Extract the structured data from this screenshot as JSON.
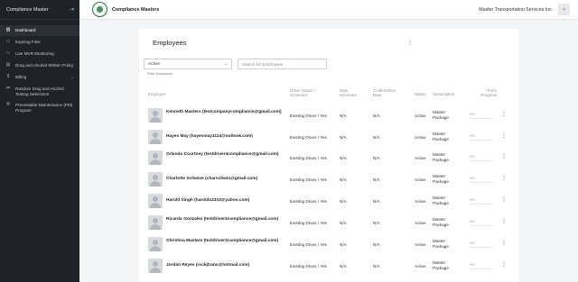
{
  "sidebar": {
    "title": "Compliance Master",
    "collapse_icon": "collapse-left-icon",
    "items": [
      {
        "label": "Dashboard",
        "icon": "chart-icon",
        "active": true
      },
      {
        "label": "Expiring Files",
        "icon": "folder-icon"
      },
      {
        "label": "Live MVR Monitoring",
        "icon": "pulse-icon"
      },
      {
        "label": "Drug and Alcohol Written Policy",
        "icon": "document-icon"
      },
      {
        "label": "Billing",
        "icon": "dollar-icon",
        "caret": "⌄"
      },
      {
        "label": "Random Drug and Alcohol Testing Selections",
        "icon": "shuffle-icon"
      },
      {
        "label": "Preventable Maintenance (PM) Program",
        "icon": "wrench-icon"
      }
    ]
  },
  "topbar": {
    "brand": "Compliance Masters",
    "company": "Master Transportation Services Inc."
  },
  "employees": {
    "title": "Employees",
    "menu_glyph": "⋮",
    "status_value": "Active",
    "search_placeholder": "Search for Employees",
    "filter_label": "Filter Employees",
    "columns": {
      "employee": "Employee",
      "driver_status": "Driver Status / Screened",
      "date_screened": "Date Screened",
      "confirmation_date": "Confirmation Date",
      "status": "Status",
      "subscription": "Subscription",
      "form_progress": "Form Progress"
    },
    "rows": [
      {
        "name": "Kenneth Masters (testcompanycompliance@gmail.com)",
        "driver": "Existing Driver / Yes",
        "screened": "N/A",
        "confirmed": "N/A",
        "status": "Active",
        "subscription": "Master Package",
        "progress": "0%",
        "progress_value": 0
      },
      {
        "name": "Hayes May (hayesmay1114@outlook.com)",
        "driver": "Existing Driver / Yes",
        "screened": "N/A",
        "confirmed": "N/A",
        "status": "Active",
        "subscription": "Master Package",
        "progress": "0%",
        "progress_value": 0
      },
      {
        "name": "Orlando Courtney (testdriver4compliance@gmail.com)",
        "driver": "Existing Driver / Yes",
        "screened": "N/A",
        "confirmed": "N/A",
        "status": "Active",
        "subscription": "Master Package",
        "progress": "0%",
        "progress_value": 0
      },
      {
        "name": "Charlotte Schwine (charschwin@gmail.com)",
        "driver": "Existing Driver / Yes",
        "screened": "N/A",
        "confirmed": "N/A",
        "status": "Active",
        "subscription": "Master Package",
        "progress": "0%",
        "progress_value": 0
      },
      {
        "name": "Harold Singh (haroldx2323@yahoo.com)",
        "driver": "Existing Driver / Yes",
        "screened": "N/A",
        "confirmed": "N/A",
        "status": "Active",
        "subscription": "Master Package",
        "progress": "0%",
        "progress_value": 0
      },
      {
        "name": "Ricardo Gonzalez (testdriver2compliance@gmail.com)",
        "driver": "Existing Driver / Yes",
        "screened": "N/A",
        "confirmed": "N/A",
        "status": "Active",
        "subscription": "Master Package",
        "progress": "0%",
        "progress_value": 0
      },
      {
        "name": "Christina Masters (testdriver3compliance@gmail.com)",
        "driver": "Existing Driver / Yes",
        "screened": "N/A",
        "confirmed": "N/A",
        "status": "Active",
        "subscription": "Master Package",
        "progress": "0%",
        "progress_value": 0
      },
      {
        "name": "Jordan Reyes (rockjtrans@hotmail.com)",
        "driver": "Existing Driver / Yes",
        "screened": "N/A",
        "confirmed": "N/A",
        "status": "Active",
        "subscription": "Master Package",
        "progress": "0%",
        "progress_value": 0
      }
    ]
  },
  "colors": {
    "sidebar_bg": "#1f2228",
    "accent": "#3b7a57",
    "page_bg": "#f4f5f7"
  }
}
